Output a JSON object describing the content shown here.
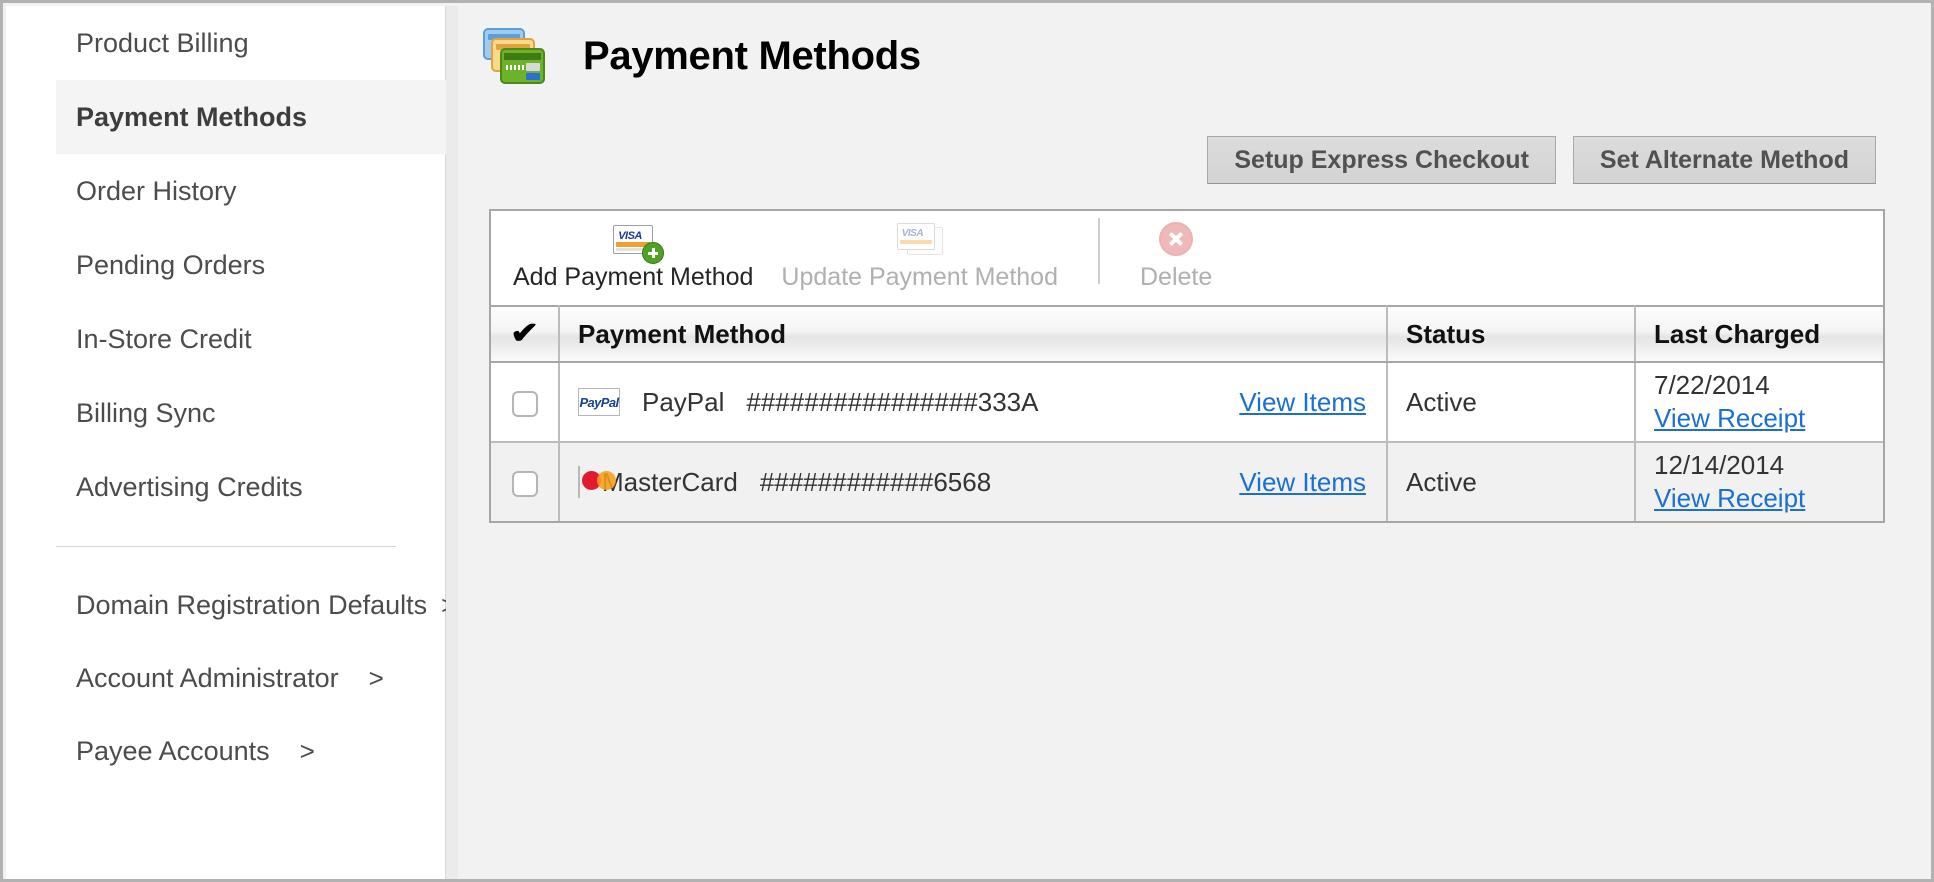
{
  "sidebar": {
    "items": [
      {
        "label": "Product Billing",
        "active": false,
        "chevron": ""
      },
      {
        "label": "Payment Methods",
        "active": true,
        "chevron": ""
      },
      {
        "label": "Order History",
        "active": false,
        "chevron": ""
      },
      {
        "label": "Pending Orders",
        "active": false,
        "chevron": ""
      },
      {
        "label": "In-Store Credit",
        "active": false,
        "chevron": ""
      },
      {
        "label": "Billing Sync",
        "active": false,
        "chevron": ""
      },
      {
        "label": "Advertising Credits",
        "active": false,
        "chevron": ""
      }
    ],
    "sub_items": [
      {
        "label": "Domain Registration Defaults",
        "chevron": ">"
      },
      {
        "label": "Account Administrator",
        "chevron": ">"
      },
      {
        "label": "Payee Accounts",
        "chevron": ">"
      }
    ]
  },
  "header": {
    "title": "Payment Methods",
    "icon": "credit-cards-stack-icon"
  },
  "action_buttons": [
    {
      "label": "Setup Express Checkout",
      "name": "setup-express-checkout-button"
    },
    {
      "label": "Set Alternate Method",
      "name": "set-alternate-method-button"
    }
  ],
  "toolbar": {
    "items": [
      {
        "label": "Add Payment Method",
        "icon": "visa-card-plus-icon",
        "disabled": false
      },
      {
        "label": "Update Payment Method",
        "icon": "visa-card-stack-icon",
        "disabled": true
      },
      {
        "label": "Delete",
        "icon": "delete-x-circle-icon",
        "disabled": true
      }
    ]
  },
  "table": {
    "columns": [
      {
        "label": "",
        "icon": "checkmark-icon"
      },
      {
        "label": "Payment Method"
      },
      {
        "label": "Status"
      },
      {
        "label": "Last Charged"
      }
    ],
    "rows": [
      {
        "selected": false,
        "logo": "paypal-logo-icon",
        "method_name": "PayPal",
        "masked_number": "################333A",
        "view_items_label": "View Items",
        "status": "Active",
        "last_charged_date": "7/22/2014",
        "view_receipt_label": "View Receipt"
      },
      {
        "selected": false,
        "logo": "mastercard-logo-icon",
        "method_name": "MasterCard",
        "masked_number": "############6568",
        "view_items_label": "View Items",
        "status": "Active",
        "last_charged_date": "12/14/2014",
        "view_receipt_label": "View Receipt"
      }
    ]
  },
  "colors": {
    "link": "#1a6fd4",
    "page_background": "#f2f2f2",
    "sidebar_background": "#ffffff",
    "active_nav_background": "#f4f4f4",
    "button_face": "#d8d8d8",
    "row_alt_background": "#f1f1f1"
  }
}
